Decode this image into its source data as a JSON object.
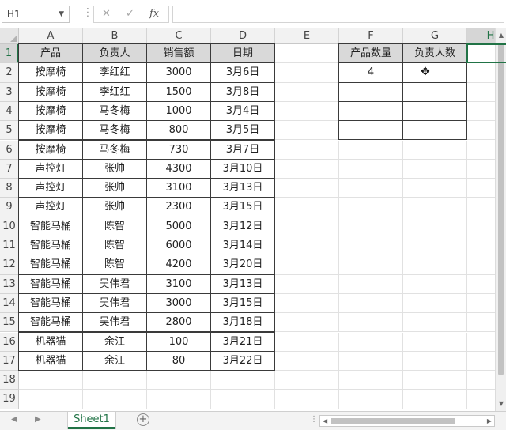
{
  "name_box": "H1",
  "formula_bar": {
    "cancel_icon": "✕",
    "enter_icon": "✓",
    "fx_icon": "fx",
    "value": ""
  },
  "columns": [
    "A",
    "B",
    "C",
    "D",
    "E",
    "F",
    "G",
    "H"
  ],
  "rows": [
    "1",
    "2",
    "3",
    "4",
    "5",
    "6",
    "7",
    "8",
    "9",
    "10",
    "11",
    "12",
    "13",
    "14",
    "15",
    "16",
    "17",
    "18",
    "19"
  ],
  "table": {
    "headers": [
      "产品",
      "负责人",
      "销售额",
      "日期"
    ],
    "rows": [
      [
        "按摩椅",
        "李红红",
        "3000",
        "3月6日"
      ],
      [
        "按摩椅",
        "李红红",
        "1500",
        "3月8日"
      ],
      [
        "按摩椅",
        "马冬梅",
        "1000",
        "3月4日"
      ],
      [
        "按摩椅",
        "马冬梅",
        "800",
        "3月5日"
      ],
      [
        "按摩椅",
        "马冬梅",
        "730",
        "3月7日"
      ],
      [
        "声控灯",
        "张帅",
        "4300",
        "3月10日"
      ],
      [
        "声控灯",
        "张帅",
        "3100",
        "3月13日"
      ],
      [
        "声控灯",
        "张帅",
        "2300",
        "3月15日"
      ],
      [
        "智能马桶",
        "陈智",
        "5000",
        "3月12日"
      ],
      [
        "智能马桶",
        "陈智",
        "6000",
        "3月14日"
      ],
      [
        "智能马桶",
        "陈智",
        "4200",
        "3月20日"
      ],
      [
        "智能马桶",
        "吴伟君",
        "3100",
        "3月13日"
      ],
      [
        "智能马桶",
        "吴伟君",
        "3000",
        "3月15日"
      ],
      [
        "智能马桶",
        "吴伟君",
        "2800",
        "3月18日"
      ],
      [
        "机器猫",
        "余江",
        "100",
        "3月21日"
      ],
      [
        "机器猫",
        "余江",
        "80",
        "3月22日"
      ]
    ]
  },
  "summary": {
    "headers": [
      "产品数量",
      "负责人数"
    ],
    "rows": [
      [
        "4",
        ""
      ],
      [
        "",
        ""
      ],
      [
        "",
        ""
      ],
      [
        "",
        ""
      ]
    ]
  },
  "active_cell": "H1",
  "sheet_tabs": [
    "Sheet1"
  ],
  "add_sheet_label": "+",
  "tab_overflow": "⋮",
  "colors": {
    "accent": "#217346",
    "header_fill": "#d9d9d9",
    "border": "#3a3a3a"
  },
  "icons": {
    "cursor": "cross-cursor",
    "add": "plus-circle"
  }
}
